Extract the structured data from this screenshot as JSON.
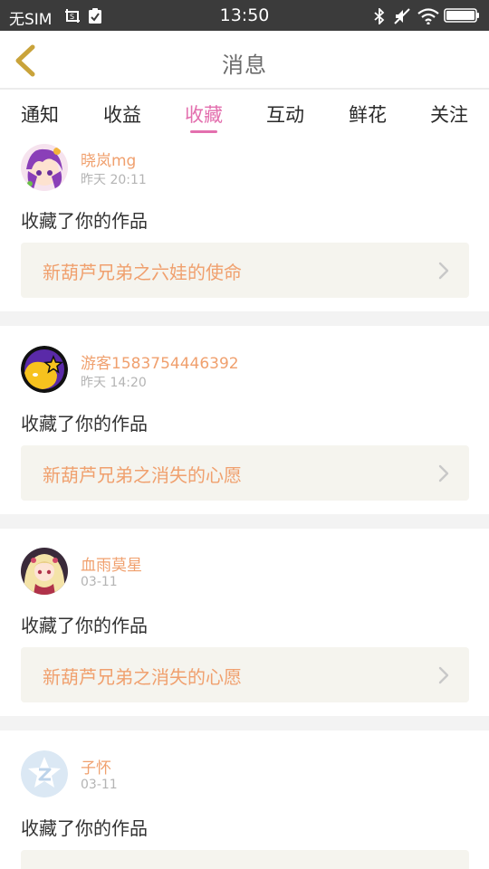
{
  "status_bar": {
    "carrier": "无SIM",
    "time": "13:50",
    "icons": [
      "screenshot-icon",
      "clipboard-check-icon",
      "bluetooth-icon",
      "mute-icon",
      "wifi-icon",
      "battery-icon"
    ]
  },
  "header": {
    "title": "消息",
    "back_icon": "chevron-left-icon"
  },
  "tabs": [
    {
      "label": "通知",
      "active": false
    },
    {
      "label": "收益",
      "active": false
    },
    {
      "label": "收藏",
      "active": true
    },
    {
      "label": "互动",
      "active": false
    },
    {
      "label": "鲜花",
      "active": false
    },
    {
      "label": "关注",
      "active": false
    }
  ],
  "colors": {
    "accent": "#e36fae",
    "username": "#f0a06e",
    "work_bg": "#f5f4ee",
    "status_bar": "#3b3b3b",
    "back_icon": "#c9a33a"
  },
  "feed": [
    {
      "username": "晓岚mg",
      "time": "昨天 20:11",
      "action": "收藏了你的作品",
      "work_title": "新葫芦兄弟之六娃的使命"
    },
    {
      "username": "游客1583754446392",
      "time": "昨天 14:20",
      "action": "收藏了你的作品",
      "work_title": "新葫芦兄弟之消失的心愿"
    },
    {
      "username": "血雨莫星",
      "time": "03-11",
      "action": "收藏了你的作品",
      "work_title": "新葫芦兄弟之消失的心愿"
    },
    {
      "username": "子怀",
      "time": "03-11",
      "action": "收藏了你的作品",
      "work_title": ""
    }
  ]
}
